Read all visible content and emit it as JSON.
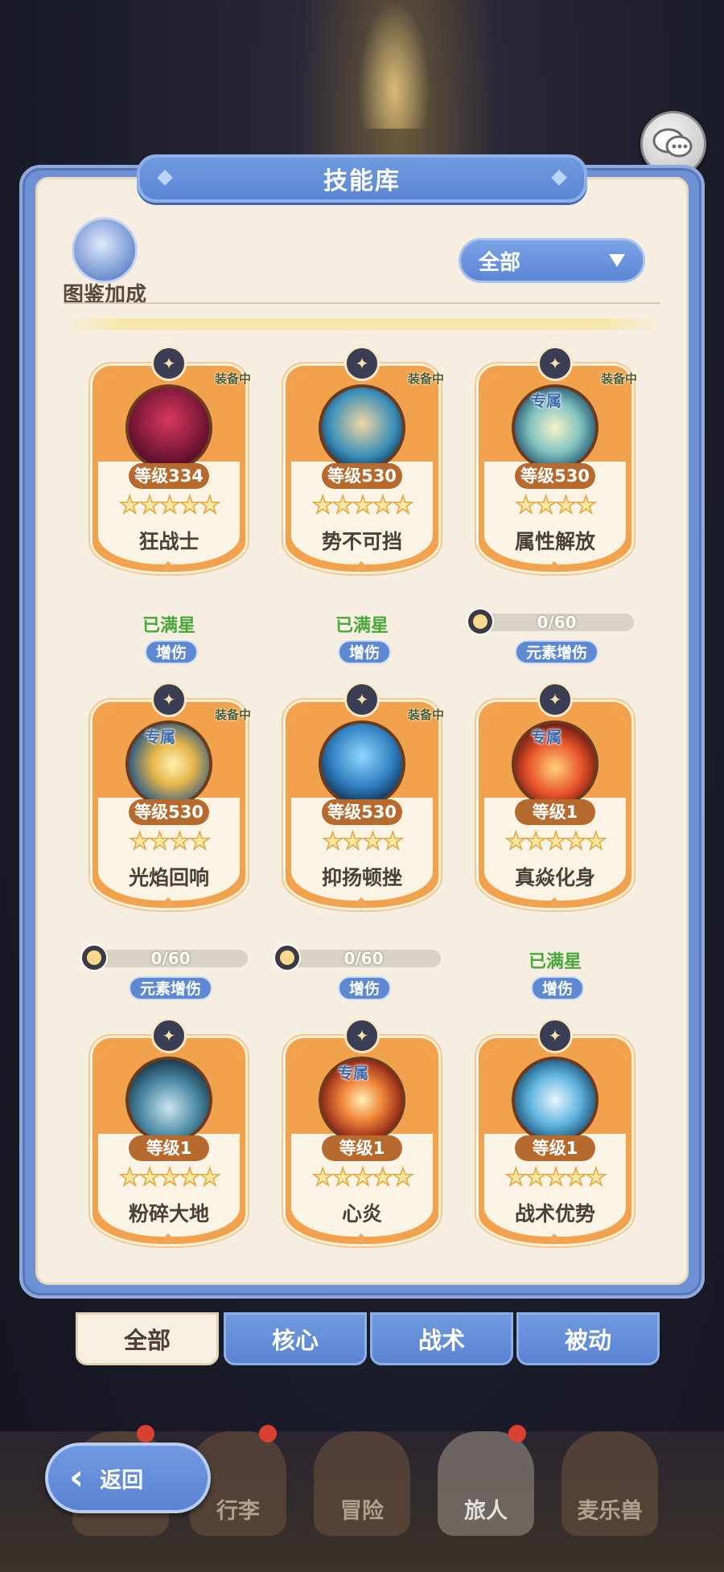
{
  "header": {
    "title": "技能库"
  },
  "album": {
    "label": "图鉴加成",
    "icon": "sparkle-feather-icon"
  },
  "filter": {
    "selected": "全部"
  },
  "skills": [
    {
      "name": "狂战士",
      "level": "等级334",
      "stars": "★★★★★",
      "equipped": "装备中",
      "exclusive": "",
      "status": "已满星",
      "progress": "",
      "tag": "增伤"
    },
    {
      "name": "势不可挡",
      "level": "等级530",
      "stars": "★★★★★",
      "equipped": "装备中",
      "exclusive": "",
      "status": "已满星",
      "progress": "",
      "tag": "增伤"
    },
    {
      "name": "属性解放",
      "level": "等级530",
      "stars": "★★★★",
      "equipped": "装备中",
      "exclusive": "专属",
      "status": "",
      "progress": "0/60",
      "tag": "元素增伤"
    },
    {
      "name": "光焰回响",
      "level": "等级530",
      "stars": "★★★★",
      "equipped": "装备中",
      "exclusive": "专属",
      "status": "",
      "progress": "0/60",
      "tag": "元素增伤"
    },
    {
      "name": "抑扬顿挫",
      "level": "等级530",
      "stars": "★★★★",
      "equipped": "装备中",
      "exclusive": "",
      "status": "",
      "progress": "0/60",
      "tag": "增伤"
    },
    {
      "name": "真焱化身",
      "level": "等级1",
      "stars": "★★★★★",
      "equipped": "",
      "exclusive": "专属",
      "status": "已满星",
      "progress": "",
      "tag": "增伤"
    },
    {
      "name": "粉碎大地",
      "level": "等级1",
      "stars": "★★★★★",
      "equipped": "",
      "exclusive": "",
      "status": "",
      "progress": "",
      "tag": ""
    },
    {
      "name": "心炎",
      "level": "等级1",
      "stars": "★★★★★",
      "equipped": "",
      "exclusive": "专属",
      "status": "",
      "progress": "",
      "tag": ""
    },
    {
      "name": "战术优势",
      "level": "等级1",
      "stars": "★★★★★",
      "equipped": "",
      "exclusive": "",
      "status": "",
      "progress": "",
      "tag": ""
    }
  ],
  "tabs": [
    "全部",
    "核心",
    "战术",
    "被动"
  ],
  "nav": [
    "行李",
    "冒险",
    "旅人",
    "麦乐兽"
  ],
  "back": {
    "label": "返回"
  },
  "colors": {
    "accent": "#5f88d3",
    "card": "#f2a24c",
    "maxstar": "#49a83a"
  }
}
